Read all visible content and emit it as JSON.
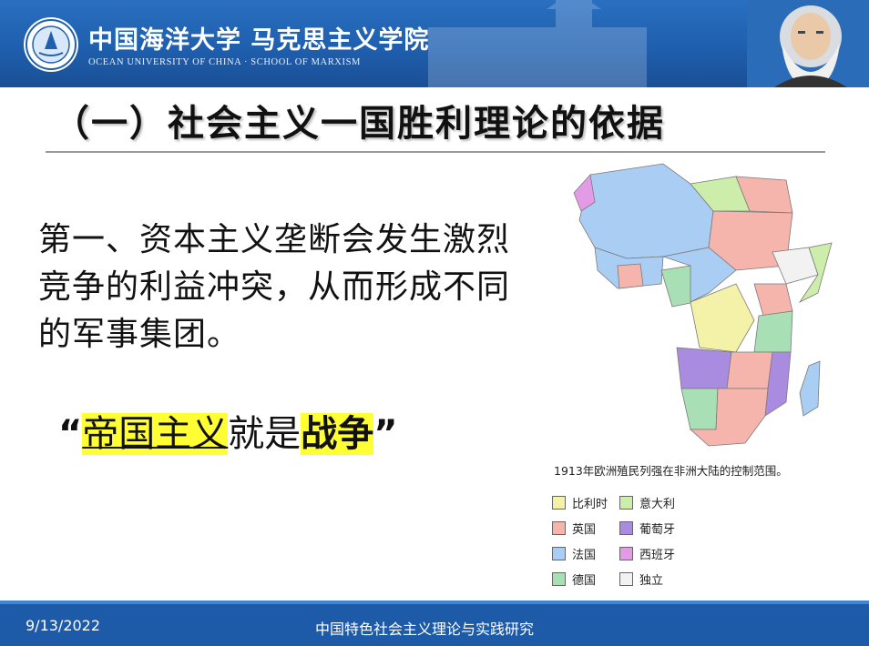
{
  "header": {
    "brand_cn": "中国海洋大学 马克思主义学院",
    "brand_en": "OCEAN UNIVERSITY OF CHINA  ·  SCHOOL OF MARXISM",
    "logo_icon": "university-seal-icon",
    "portrait_icon": "marx-portrait-icon",
    "colors": {
      "banner": "#1f5fae",
      "footer": "#1d5aa8"
    }
  },
  "slide": {
    "title": "（一）社会主义一国胜利理论的依据",
    "paragraph": "第一、资本主义垄断会发生激烈竞争的利益冲突，从而形成不同的军事集团。",
    "quote": {
      "open": "“",
      "part1": "帝国主义",
      "part2": "就是",
      "part3": "战争",
      "close": "”"
    }
  },
  "map": {
    "caption": "1913年欧洲殖民列强在非洲大陆的控制范围。",
    "legend": [
      {
        "label": "比利时",
        "color": "#f4f1a8"
      },
      {
        "label": "意大利",
        "color": "#cdeeaa"
      },
      {
        "label": "英国",
        "color": "#f5b5ad"
      },
      {
        "label": "葡萄牙",
        "color": "#a98be0"
      },
      {
        "label": "法国",
        "color": "#a9cdf3"
      },
      {
        "label": "西班牙",
        "color": "#e39be6"
      },
      {
        "label": "德国",
        "color": "#a8dfb4"
      },
      {
        "label": "独立",
        "color": "#f2f2f2"
      }
    ]
  },
  "footer": {
    "date": "9/13/2022",
    "course": "中国特色社会主义理论与实践研究"
  }
}
